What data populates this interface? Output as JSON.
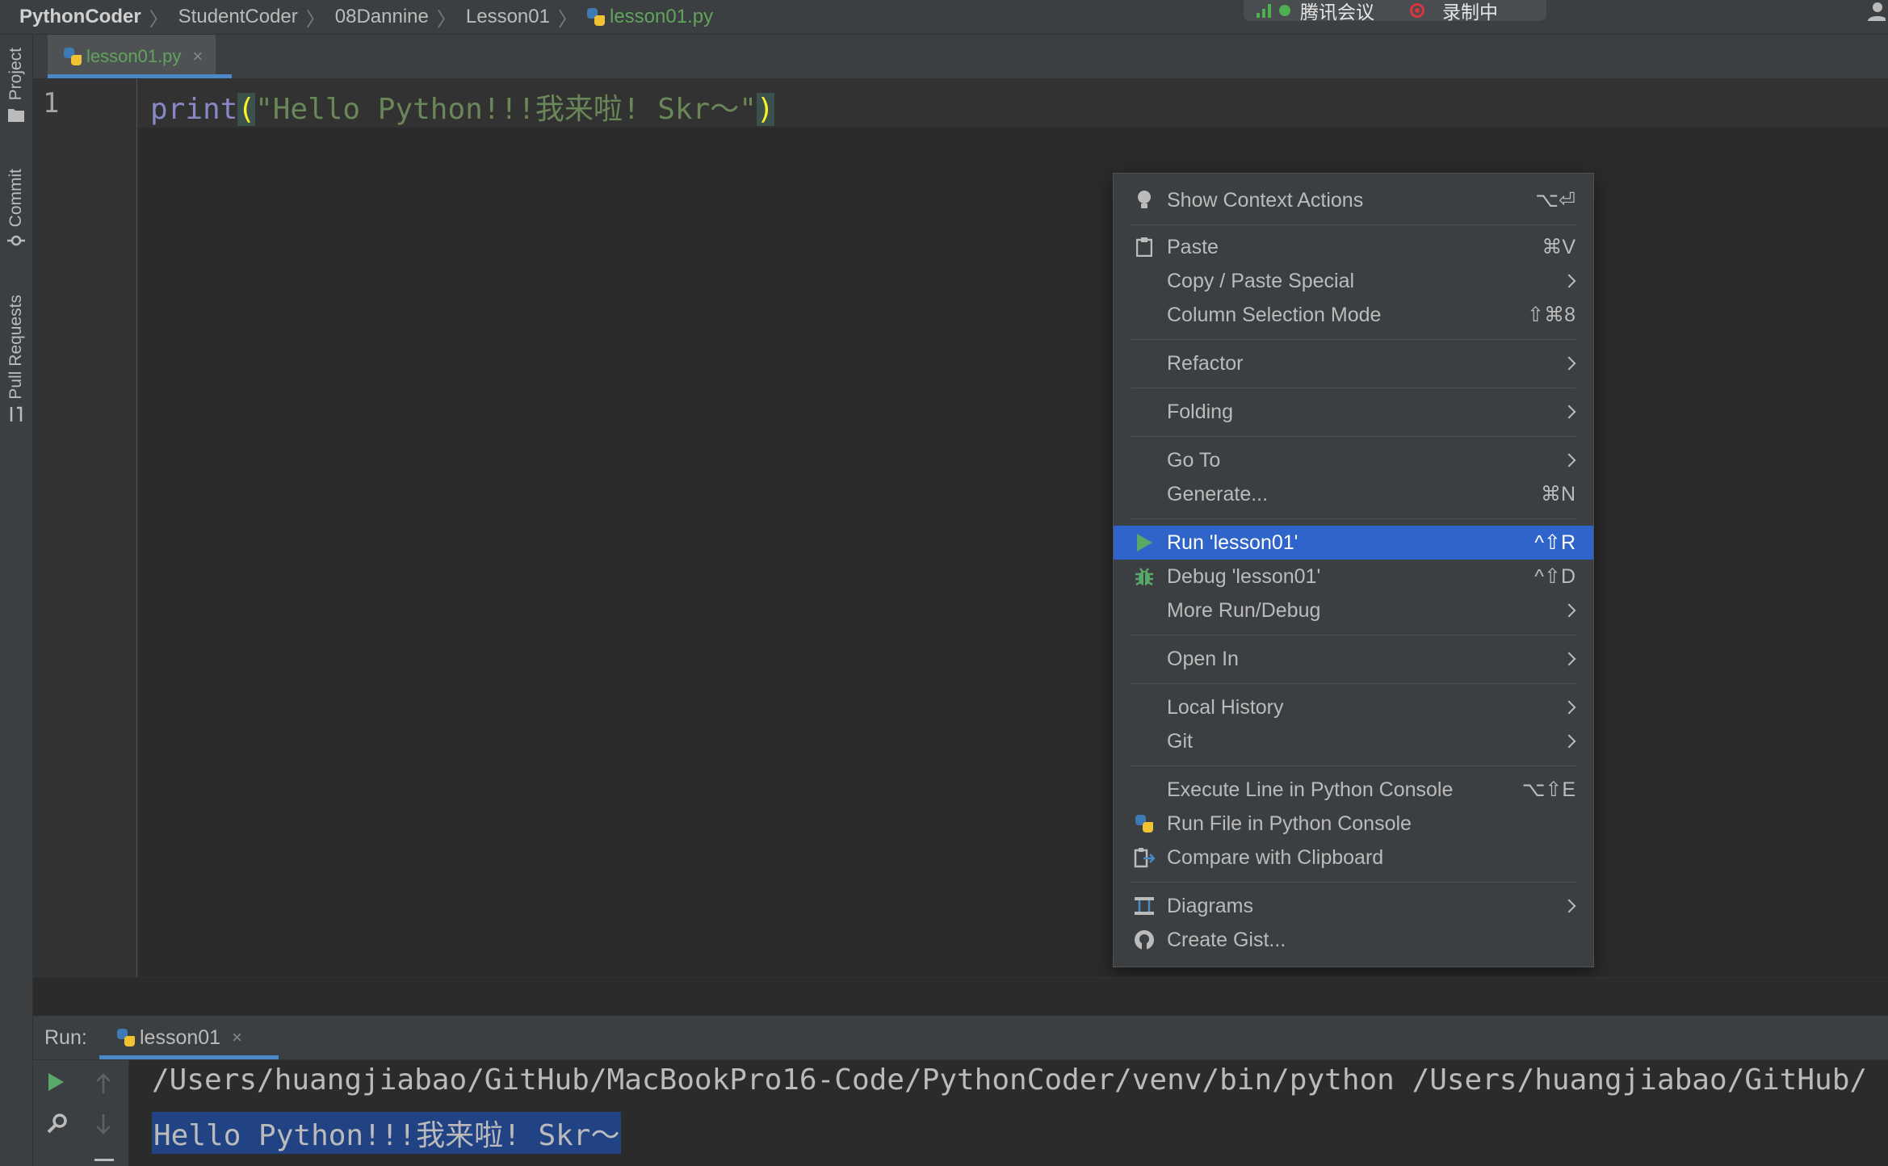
{
  "breadcrumb": {
    "items": [
      "PythonCoder",
      "StudentCoder",
      "08Dannine",
      "Lesson01"
    ],
    "file": "lesson01.py"
  },
  "meeting_overlay": {
    "app": "腾讯会议",
    "recording": "录制中"
  },
  "left_stripe": {
    "project": "Project",
    "commit": "Commit",
    "pull_requests": "Pull Requests"
  },
  "editor": {
    "tab": {
      "label": "lesson01.py",
      "close": "×"
    },
    "line_number": "1",
    "code": {
      "keyword": "print",
      "open_paren": "(",
      "string": "\"Hello Python!!!我来啦! Skr～\"",
      "close_paren": ")"
    }
  },
  "context_menu": {
    "items": [
      {
        "label": "Show Context Actions",
        "shortcut": "⌥⏎",
        "icon": "bulb-icon"
      },
      {
        "label": "Paste",
        "shortcut": "⌘V",
        "icon": "clipboard-icon"
      },
      {
        "label": "Copy / Paste Special",
        "submenu": true
      },
      {
        "label": "Column Selection Mode",
        "shortcut": "⇧⌘8"
      },
      {
        "label": "Refactor",
        "submenu": true
      },
      {
        "label": "Folding",
        "submenu": true
      },
      {
        "label": "Go To",
        "submenu": true
      },
      {
        "label": "Generate...",
        "shortcut": "⌘N"
      },
      {
        "label": "Run 'lesson01'",
        "shortcut": "^⇧R",
        "icon": "run-icon",
        "selected": true
      },
      {
        "label": "Debug 'lesson01'",
        "shortcut": "^⇧D",
        "icon": "debug-icon"
      },
      {
        "label": "More Run/Debug",
        "submenu": true
      },
      {
        "label": "Open In",
        "submenu": true
      },
      {
        "label": "Local History",
        "submenu": true
      },
      {
        "label": "Git",
        "submenu": true
      },
      {
        "label": "Execute Line in Python Console",
        "shortcut": "⌥⇧E"
      },
      {
        "label": "Run File in Python Console",
        "icon": "python-icon"
      },
      {
        "label": "Compare with Clipboard",
        "icon": "compare-icon"
      },
      {
        "label": "Diagrams",
        "submenu": true,
        "icon": "diagram-icon"
      },
      {
        "label": "Create Gist...",
        "icon": "github-icon"
      }
    ]
  },
  "run_panel": {
    "label": "Run:",
    "tab": {
      "label": "lesson01",
      "close": "×"
    },
    "output": [
      "/Users/huangjiabao/GitHub/MacBookPro16-Code/PythonCoder/venv/bin/python /Users/huangjiabao/GitHub/",
      "Hello Python!!!我来啦! Skr～"
    ]
  },
  "colors": {
    "selection": "#2f65ca",
    "accent": "#4a88c7",
    "string": "#6a8759",
    "keyword": "#8888c6",
    "paren": "#ffef28"
  }
}
